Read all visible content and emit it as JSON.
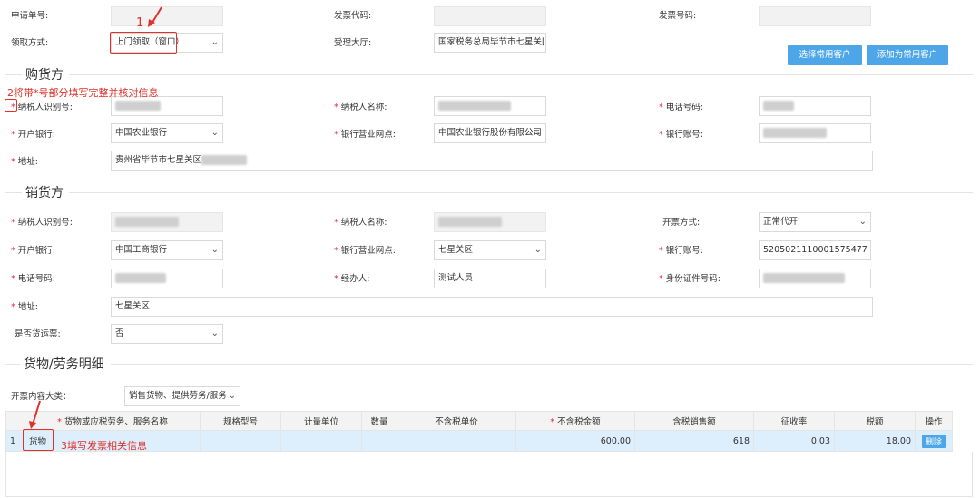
{
  "top": {
    "apply_no_label": "申请单号:",
    "invoice_code_label": "发票代码:",
    "invoice_no_label": "发票号码:",
    "receive_method_label": "领取方式:",
    "receive_method_value": "上门领取（窗口）",
    "hall_label": "受理大厅:",
    "hall_value": "国家税务总局毕节市七星关[",
    "btn_select_customer": "选择常用客户",
    "btn_add_customer": "添加为常用客户"
  },
  "buyer": {
    "section_title": "购货方",
    "taxpayer_id_label": "纳税人识别号:",
    "taxpayer_name_label": "纳税人名称:",
    "phone_label": "电话号码:",
    "bank_label": "开户银行:",
    "bank_value": "中国农业银行",
    "branch_label": "银行营业网点:",
    "branch_value": "中国农业银行股份有限公司",
    "account_label": "银行账号:",
    "address_label": "地址:",
    "address_value": "贵州省毕节市七星关区"
  },
  "seller": {
    "section_title": "销货方",
    "taxpayer_id_label": "纳税人识别号:",
    "taxpayer_name_label": "纳税人名称:",
    "invoice_method_label": "开票方式:",
    "invoice_method_value": "正常代开",
    "bank_label": "开户银行:",
    "bank_value": "中国工商银行",
    "branch_label": "银行营业网点:",
    "branch_value": "七星关区",
    "account_label": "银行账号:",
    "account_value": "5205021110001575477",
    "phone_label": "电话号码:",
    "handler_label": "经办人:",
    "handler_value": "测试人员",
    "id_no_label": "身份证件号码:",
    "address_label": "地址:",
    "address_value": "七星关区",
    "freight_label": "是否货运票:",
    "freight_value": "否"
  },
  "goods": {
    "section_title": "货物/劳务明细",
    "category_label": "开票内容大类：",
    "category_value": "销售货物、提供劳务/服务",
    "columns": [
      "货物或应税劳务、服务名称",
      "规格型号",
      "计量单位",
      "数量",
      "不含税单价",
      "不含税金额",
      "含税销售额",
      "征收率",
      "税额",
      "操作"
    ],
    "row": {
      "index": "1",
      "name": "货物",
      "amount_excl_tax": "600.00",
      "amount_incl_tax": "618",
      "rate": "0.03",
      "tax": "18.00",
      "action": "删除"
    }
  },
  "annotations": {
    "a1": "1",
    "a2": "2将带*号部分填写完整并核对信息",
    "a3": "3填写发票相关信息"
  },
  "colors": {
    "accent": "#4da6e8",
    "annotation": "#e0312a"
  }
}
